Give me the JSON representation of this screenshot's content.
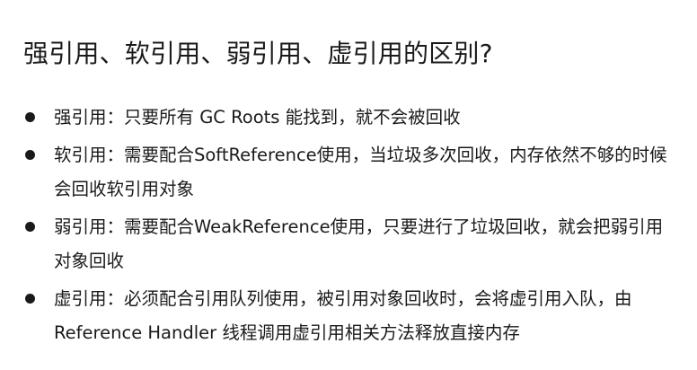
{
  "slide": {
    "title": "强引用、软引用、弱引用、虚引用的区别?",
    "bullets": [
      "强引用：只要所有 GC Roots 能找到，就不会被回收",
      "软引用：需要配合SoftReference使用，当垃圾多次回收，内存依然不够的时候会回收软引用对象",
      "弱引用：需要配合WeakReference使用，只要进行了垃圾回收，就会把弱引用对象回收",
      "虚引用：必须配合引用队列使用，被引用对象回收时，会将虚引用入队，由 Reference Handler 线程调用虚引用相关方法释放直接内存"
    ]
  }
}
